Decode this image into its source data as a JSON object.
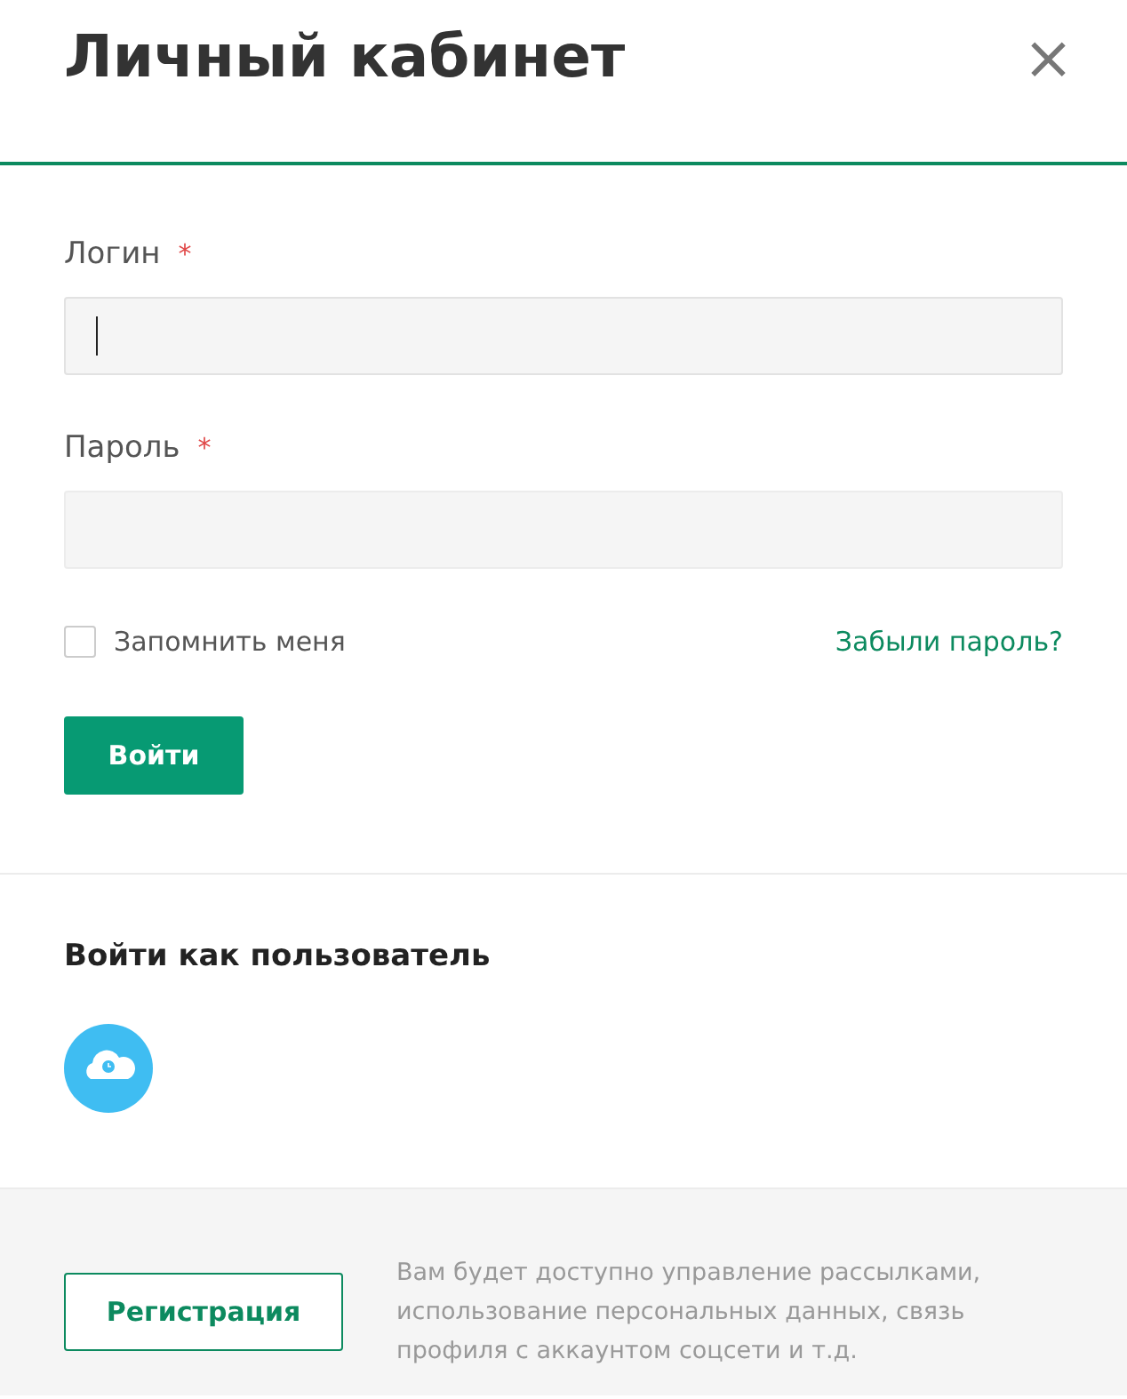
{
  "header": {
    "title": "Личный кабинет",
    "close": "×"
  },
  "fields": [
    {
      "label": "Логин",
      "required_mark": "*",
      "focused": true
    },
    {
      "label": "Пароль",
      "required_mark": "*",
      "focused": false
    }
  ],
  "remember": {
    "label": "Запомнить меня",
    "checked": false
  },
  "forgot_link": "Забыли пароль?",
  "submit": "Войти",
  "social": {
    "title": "Войти как пользователь"
  },
  "footer": {
    "register": "Регистрация",
    "note": "Вам будет доступно управление рассылками, использование персональных данных, связь профиля с аккаунтом соцсети и т.д."
  }
}
